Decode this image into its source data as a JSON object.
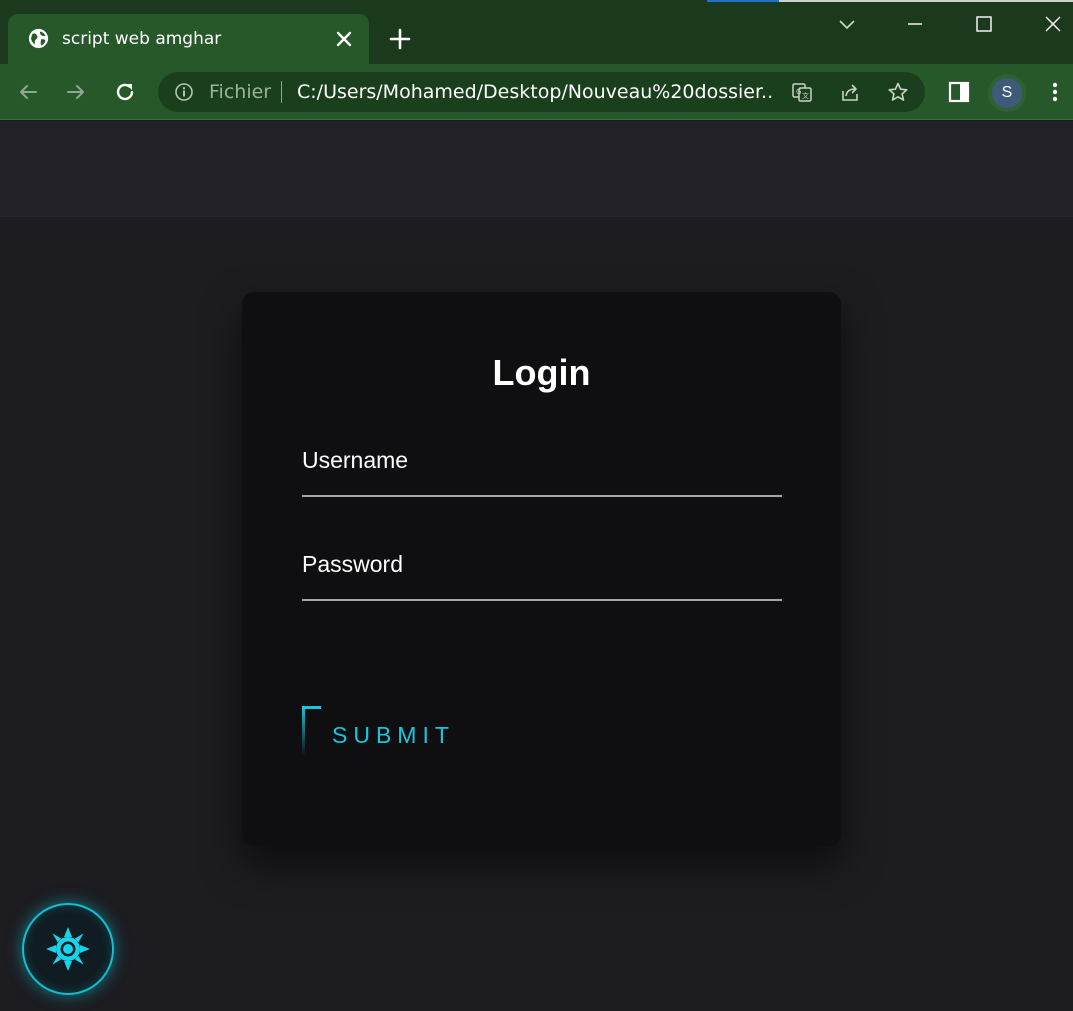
{
  "browser": {
    "tab": {
      "title": "script web amghar",
      "favicon": "globe-icon"
    },
    "omnibox": {
      "security_label": "Fichier",
      "url": "C:/Users/Mohamed/Desktop/Nouveau%20dossier..."
    },
    "profile_initial": "S",
    "colors": {
      "titlebar": "#1b3a1d",
      "toolbar": "#27582a"
    }
  },
  "login": {
    "title": "Login",
    "username_label": "Username",
    "password_label": "Password",
    "submit_label": "SUBMIT"
  },
  "theme_toggle": {
    "icon": "sun-icon",
    "accent": "#18c6dc"
  }
}
